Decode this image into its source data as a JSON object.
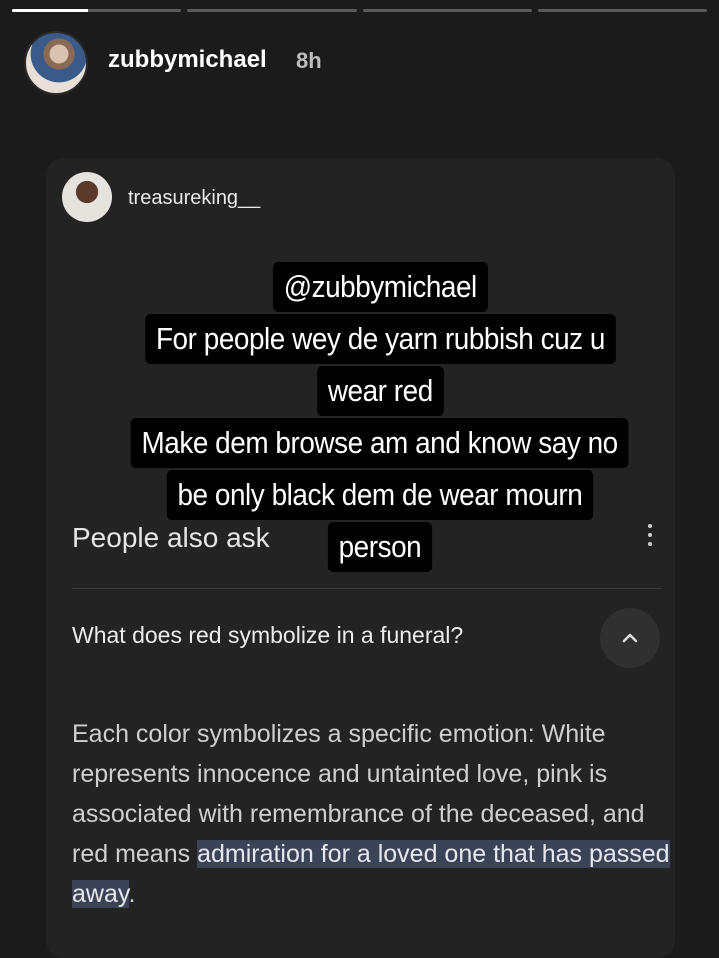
{
  "story": {
    "progress_segments": [
      1,
      0,
      0,
      0
    ],
    "active_segment_fill": 0.45,
    "username": "zubbymichael",
    "time_ago": "8h"
  },
  "shared_post": {
    "username": "treasureking__"
  },
  "overlay_lines": [
    "@zubbymichael",
    "For people wey de yarn rubbish cuz u",
    "wear red",
    "Make dem browse am and know say no",
    "be only black dem de wear mourn",
    "person"
  ],
  "search": {
    "section_title": "People also ask",
    "question": "What does red symbolize in a funeral?",
    "answer_plain": "Each color symbolizes a specific emotion: White represents innocence and untainted love, pink is associated with remembrance of the deceased, and red means ",
    "answer_highlight": "admiration for a loved one that has passed away",
    "answer_end": "."
  },
  "colors": {
    "background": "#1b1b1b",
    "highlight": "#3b4357"
  }
}
